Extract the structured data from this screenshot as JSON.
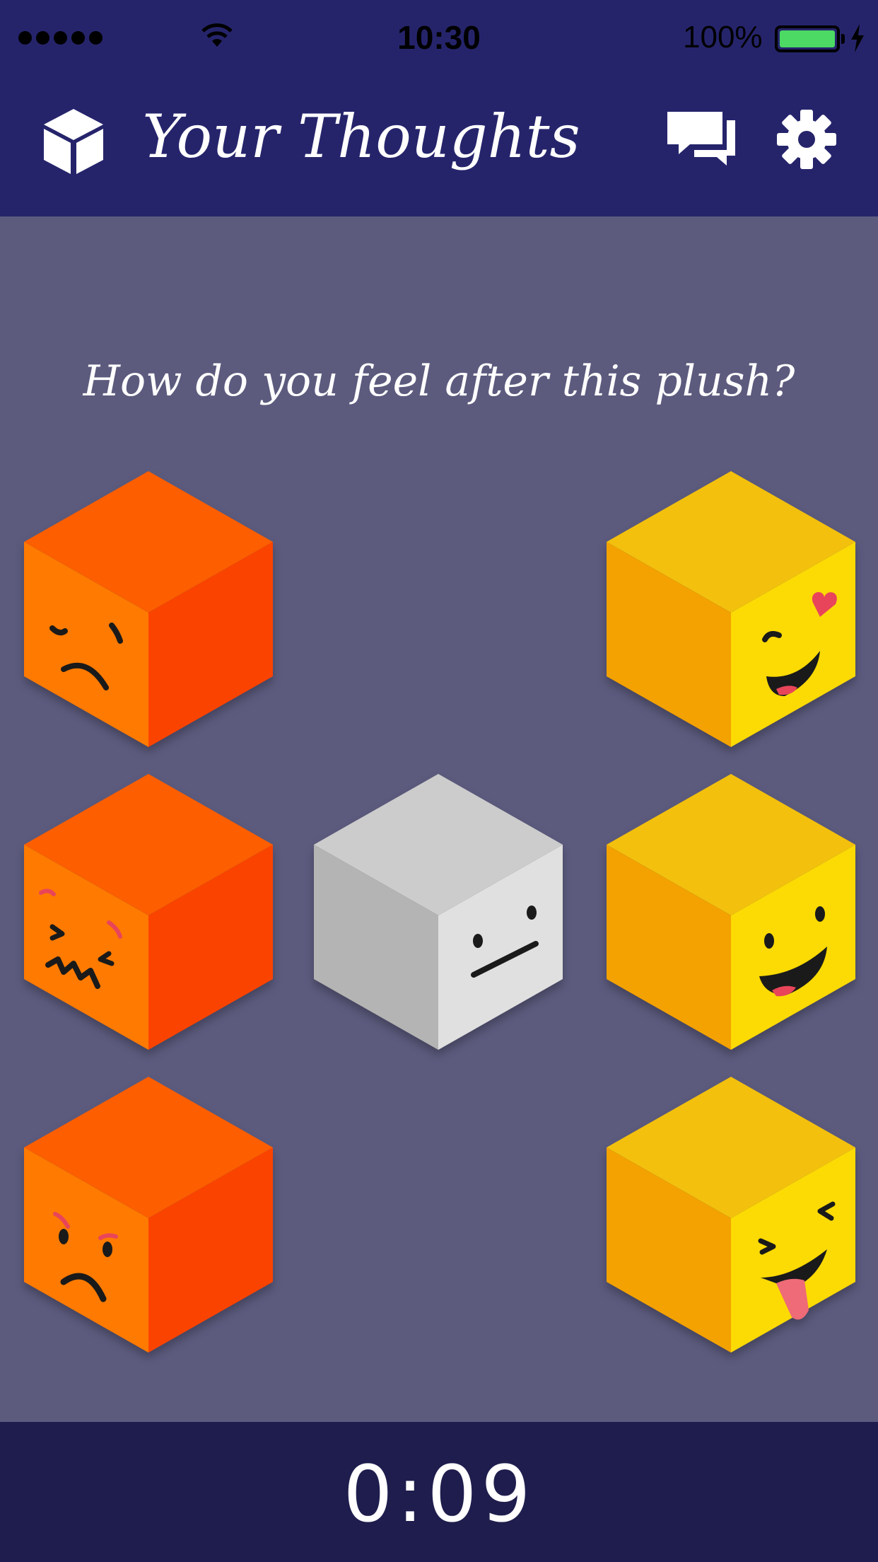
{
  "status_bar": {
    "time": "10:30",
    "battery_percent": "100%",
    "signal_bars": 5
  },
  "nav": {
    "title": "Your Thoughts",
    "left_icon": "cube-icon",
    "right_icons": [
      "chat-icon",
      "gear-icon"
    ]
  },
  "prompt": "How do you feel after this plush?",
  "moods": [
    {
      "id": "worried",
      "color": "orange"
    },
    {
      "id": "love",
      "color": "yellow"
    },
    {
      "id": "dizzy",
      "color": "orange"
    },
    {
      "id": "neutral",
      "color": "gray"
    },
    {
      "id": "happy",
      "color": "yellow"
    },
    {
      "id": "angry",
      "color": "orange"
    },
    {
      "id": "playful",
      "color": "yellow"
    }
  ],
  "colors": {
    "header": "#25246b",
    "background": "#5c5b7e",
    "footer": "#1e1d4d",
    "orange_top": "#fc5e00",
    "orange_left": "#ff7a00",
    "orange_right": "#fb4300",
    "yellow_top": "#f3c00d",
    "yellow_left": "#f3a201",
    "yellow_right": "#fcda04",
    "gray_top": "#cccccc",
    "gray_left": "#b4b4b4",
    "gray_right": "#e0e0e0",
    "battery_green": "#4cd964"
  },
  "timer": "0:09"
}
